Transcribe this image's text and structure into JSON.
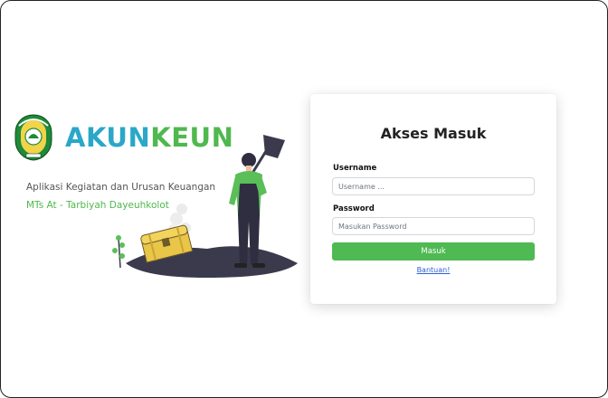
{
  "branding": {
    "logo_icon": "school-emblem-icon",
    "name_part1": "AKUN",
    "name_part2": "KEUN",
    "color_part1": "#2aa7c9",
    "color_part2": "#4fb84e",
    "subtitle": "Aplikasi Kegiatan dan Urusan Keuangan",
    "school": "MTs At - Tarbiyah Dayeuhkolot"
  },
  "illustration": {
    "icon": "worker-with-shovel-and-treasure-chest-icon"
  },
  "login": {
    "title": "Akses Masuk",
    "username_label": "Username",
    "username_placeholder": "Username ...",
    "password_label": "Password",
    "password_placeholder": "Masukan Password",
    "submit_label": "Masuk",
    "submit_color": "#4fb953",
    "help_link": "Bantuan!"
  }
}
